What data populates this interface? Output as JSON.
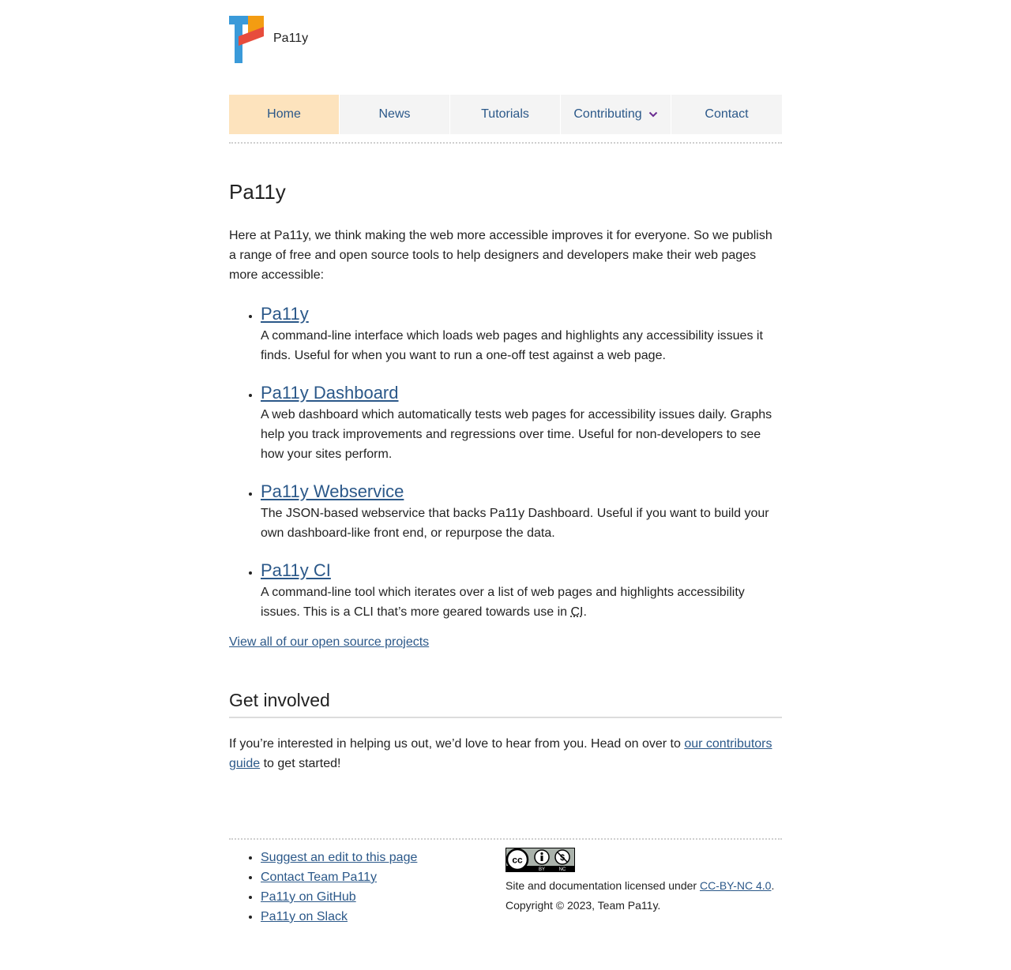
{
  "site": {
    "name": "Pa11y",
    "logo_icon": "pa11y-logo-icon"
  },
  "nav": {
    "items": [
      {
        "label": "Home",
        "active": true
      },
      {
        "label": "News",
        "active": false
      },
      {
        "label": "Tutorials",
        "active": false
      },
      {
        "label": "Contributing",
        "active": false,
        "has_dropdown": true
      },
      {
        "label": "Contact",
        "active": false
      }
    ]
  },
  "main": {
    "title": "Pa11y",
    "intro": "Here at Pa11y, we think making the web more accessible improves it for everyone. So we publish a range of free and open source tools to help designers and developers make their web pages more accessible:",
    "tools": [
      {
        "name": "Pa11y",
        "description": "A command-line interface which loads web pages and highlights any accessibility issues it finds. Useful for when you want to run a one-off test against a web page."
      },
      {
        "name": "Pa11y Dashboard",
        "description": "A web dashboard which automatically tests web pages for accessibility issues daily. Graphs help you track improvements and regressions over time. Useful for non-developers to see how your sites perform."
      },
      {
        "name": "Pa11y Webservice",
        "description": "The JSON-based webservice that backs Pa11y Dashboard. Useful if you want to build your own dashboard-like front end, or repurpose the data."
      },
      {
        "name": "Pa11y CI",
        "description_before": "A command-line tool which iterates over a list of web pages and highlights accessibility issues. This is a CLI that’s more geared towards use in ",
        "description_abbr": "CI",
        "description_after": "."
      }
    ],
    "view_all": "View all of our open source projects"
  },
  "involved": {
    "heading": "Get involved",
    "text_before": "If you’re interested in helping us out, we’d love to hear from you. Head on over to ",
    "link": "our contributors guide",
    "text_after": " to get started!"
  },
  "footer": {
    "links": [
      "Suggest an edit to this page",
      "Contact Team Pa11y",
      "Pa11y on GitHub",
      "Pa11y on Slack"
    ],
    "license_badge": {
      "icon": "cc-by-nc-badge-icon",
      "labels": [
        "BY",
        "NC"
      ]
    },
    "license_before": "Site and documentation licensed under ",
    "license_link": "CC-BY-NC 4.0",
    "license_after": ".",
    "copyright": "Copyright © 2023, Team Pa11y."
  },
  "colors": {
    "link": "#2b5889",
    "nav_bg": "#f4f4f4",
    "nav_active_bg": "#fde3bd",
    "logo_blue": "#3a9ad9",
    "logo_orange": "#f39c12",
    "logo_red": "#e74c3c"
  }
}
